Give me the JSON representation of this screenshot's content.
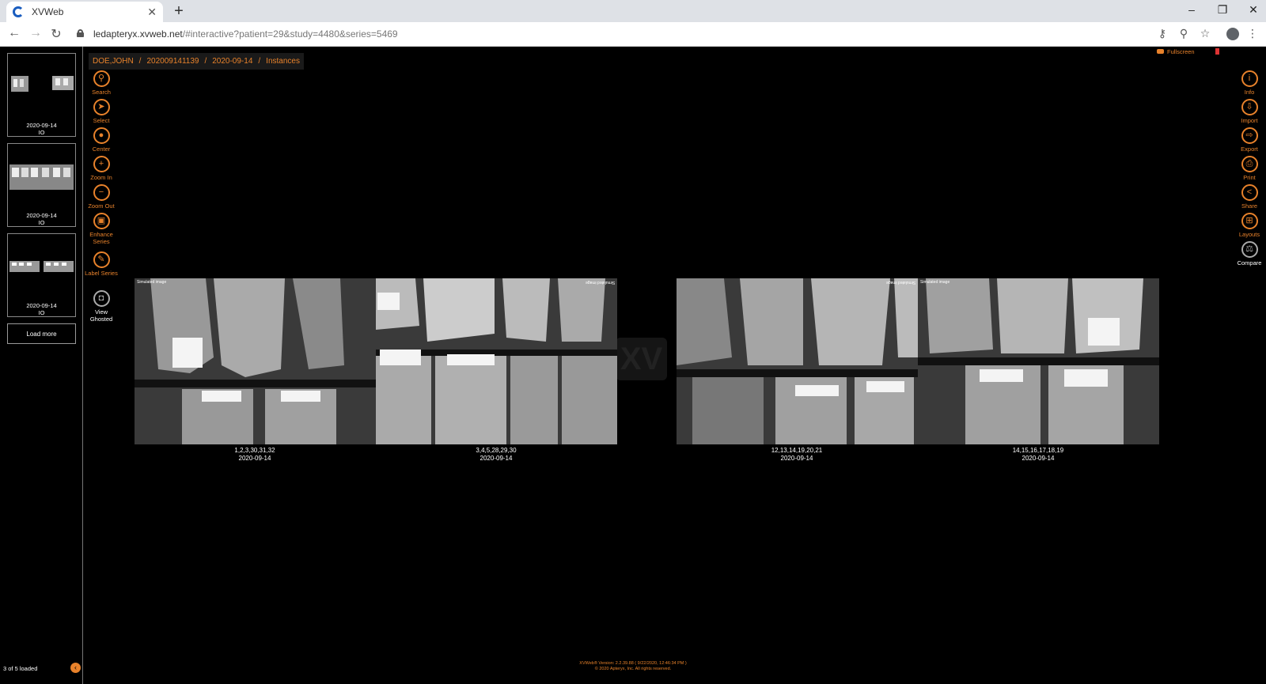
{
  "browser": {
    "tab_title": "XVWeb",
    "url_host": "ledapteryx.xvweb.net",
    "url_path": "/#interactive?patient=29&study=4480&series=5469"
  },
  "breadcrumb": [
    "DOE,JOHN",
    "202009141139",
    "2020-09-14",
    "Instances"
  ],
  "thumbnails": [
    {
      "date": "2020-09-14",
      "modality": "IO"
    },
    {
      "date": "2020-09-14",
      "modality": "IO"
    },
    {
      "date": "2020-09-14",
      "modality": "IO"
    }
  ],
  "load_more": "Load more",
  "loaded_status": "3 of 5 loaded",
  "left_tools": {
    "search": "Search",
    "select": "Select",
    "center": "Center",
    "zoom_in": "Zoom In",
    "zoom_out": "Zoom Out",
    "enhance": "Enhance Series",
    "label": "Label Series",
    "view": "View Ghosted"
  },
  "right_tools": {
    "info": "Info",
    "import": "Import",
    "export": "Export",
    "print": "Print",
    "share": "Share",
    "layouts": "Layouts",
    "compare": "Compare"
  },
  "fullscreen_label": "Fullscreen",
  "images": [
    {
      "tag": "Simulated image",
      "teeth": "1,2,3,30,31,32",
      "date": "2020-09-14"
    },
    {
      "tag": "Simulated image",
      "teeth": "3,4,5,28,29,30",
      "date": "2020-09-14"
    },
    {
      "tag": "Simulated image",
      "teeth": "12,13,14,19,20,21",
      "date": "2020-09-14"
    },
    {
      "tag": "Simulated image",
      "teeth": "14,15,16,17,18,19",
      "date": "2020-09-14"
    }
  ],
  "watermark": "XV",
  "footer": {
    "version": "XVWeb® Version: 2.2.39.88 ( 9/22/2020, 12:46:34 PM )",
    "copyright": "© 2020 Apteryx, Inc. All rights reserved."
  }
}
